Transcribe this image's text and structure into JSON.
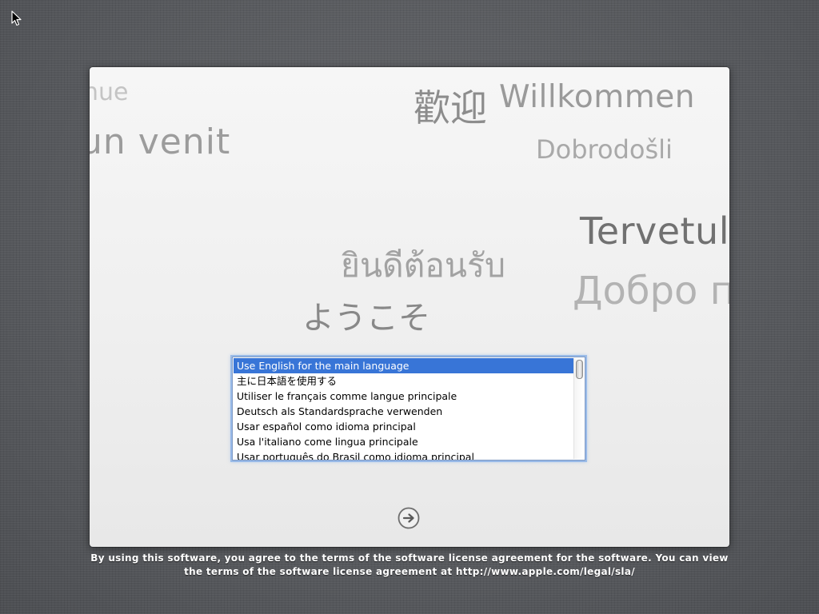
{
  "cursor": {
    "icon": "arrow-pointer-icon"
  },
  "welcome_words": {
    "nue": "nue",
    "venit": "un venit",
    "kanji": "歡迎",
    "willkommen": "Willkommen",
    "dobrodosli": "Dobrodošli",
    "tervetul": "Tervetul",
    "thai": "ยินดีต้อนรับ",
    "dobro": "Добро п",
    "youkoso": "ようこそ"
  },
  "language_list": {
    "selected_index": 0,
    "items": [
      "Use English for the main language",
      "主に日本語を使用する",
      "Utiliser le français comme langue principale",
      "Deutsch als Standardsprache verwenden",
      "Usar español como idioma principal",
      "Usa l'italiano come lingua principale",
      "Usar português do Brasil como idioma principal"
    ]
  },
  "next_button": {
    "icon": "right-arrow-circle-icon"
  },
  "license": {
    "line1": "By using this software, you agree to the terms of the software license agreement for the software. You can view",
    "line2": "the terms of the software license agreement at http://www.apple.com/legal/sla/"
  },
  "colors": {
    "selection": "#3875d7",
    "focus_ring": "#6ea0e6",
    "desktop": "#585a5e"
  }
}
